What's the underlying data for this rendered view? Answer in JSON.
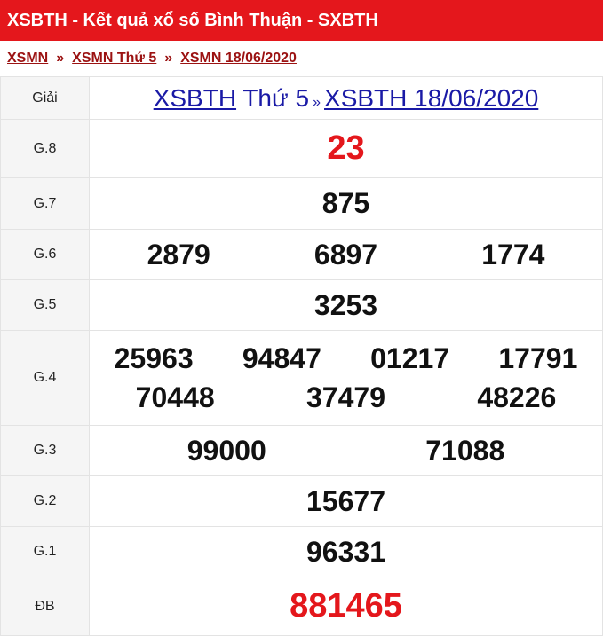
{
  "header": {
    "title": "XSBTH - Kết quả xổ số Bình Thuận - SXBTH"
  },
  "breadcrumb": {
    "items": [
      "XSMN",
      "XSMN Thứ 5",
      "XSMN 18/06/2020"
    ],
    "separator": "»"
  },
  "table": {
    "label_header": "Giải",
    "title_link1": "XSBTH",
    "title_day": "Thứ 5",
    "title_sep": "»",
    "title_link2": "XSBTH 18/06/2020",
    "prizes": [
      {
        "label": "G.8",
        "numbers": [
          "23"
        ]
      },
      {
        "label": "G.7",
        "numbers": [
          "875"
        ]
      },
      {
        "label": "G.6",
        "numbers": [
          "2879",
          "6897",
          "1774"
        ]
      },
      {
        "label": "G.5",
        "numbers": [
          "3253"
        ]
      },
      {
        "label": "G.4",
        "numbers": [
          "25963",
          "94847",
          "01217",
          "17791",
          "70448",
          "37479",
          "48226"
        ]
      },
      {
        "label": "G.3",
        "numbers": [
          "99000",
          "71088"
        ]
      },
      {
        "label": "G.2",
        "numbers": [
          "15677"
        ]
      },
      {
        "label": "G.1",
        "numbers": [
          "96331"
        ]
      },
      {
        "label": "ĐB",
        "numbers": [
          "881465"
        ]
      }
    ]
  },
  "colors": {
    "accent": "#e4171c",
    "link": "#1a1aa6",
    "breadcrumb": "#9b1212"
  }
}
